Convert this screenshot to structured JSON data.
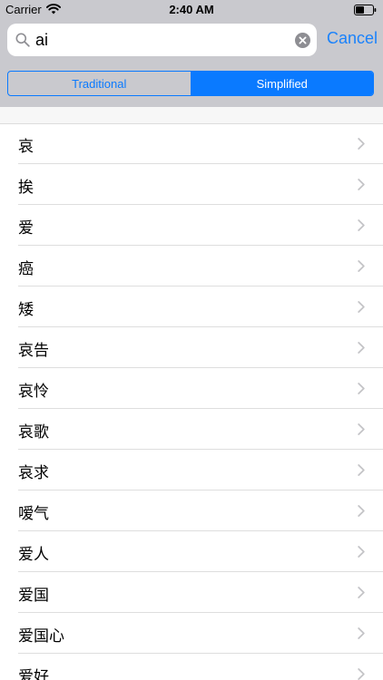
{
  "status_bar": {
    "carrier": "Carrier",
    "time": "2:40 AM"
  },
  "search": {
    "query": "ai",
    "cancel_label": "Cancel"
  },
  "segments": [
    {
      "label": "Traditional",
      "selected": false
    },
    {
      "label": "Simplified",
      "selected": true
    }
  ],
  "results": [
    {
      "label": "哀"
    },
    {
      "label": "挨"
    },
    {
      "label": "爱"
    },
    {
      "label": "癌"
    },
    {
      "label": "矮"
    },
    {
      "label": "哀告"
    },
    {
      "label": "哀怜"
    },
    {
      "label": "哀歌"
    },
    {
      "label": "哀求"
    },
    {
      "label": "嗳气"
    },
    {
      "label": "爱人"
    },
    {
      "label": "爱国"
    },
    {
      "label": "爱国心"
    },
    {
      "label": "爱好"
    }
  ],
  "colors": {
    "accent": "#0a7aff",
    "cancel": "#1a82fb",
    "bar_background": "#c9c9ce"
  }
}
